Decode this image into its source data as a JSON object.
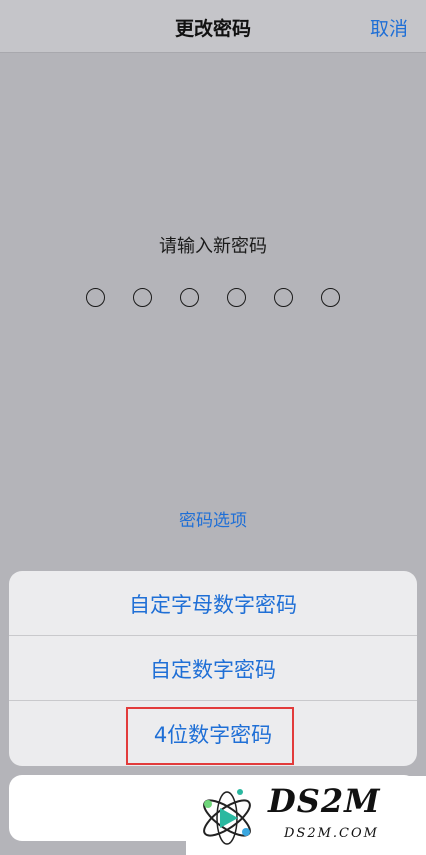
{
  "navbar": {
    "title": "更改密码",
    "cancel_label": "取消"
  },
  "passcode": {
    "prompt": "请输入新密码",
    "digit_count": 6
  },
  "options_link": "密码选项",
  "sheet": {
    "items": [
      {
        "label": "自定字母数字密码"
      },
      {
        "label": "自定数字密码"
      },
      {
        "label": "4位数字密码"
      }
    ]
  },
  "watermark": {
    "main": "DS2M",
    "sub": "DS2M.COM"
  },
  "colors": {
    "accent": "#1f6fd6",
    "highlight": "#e23b3b",
    "dim_background": "#b4b4b9"
  }
}
